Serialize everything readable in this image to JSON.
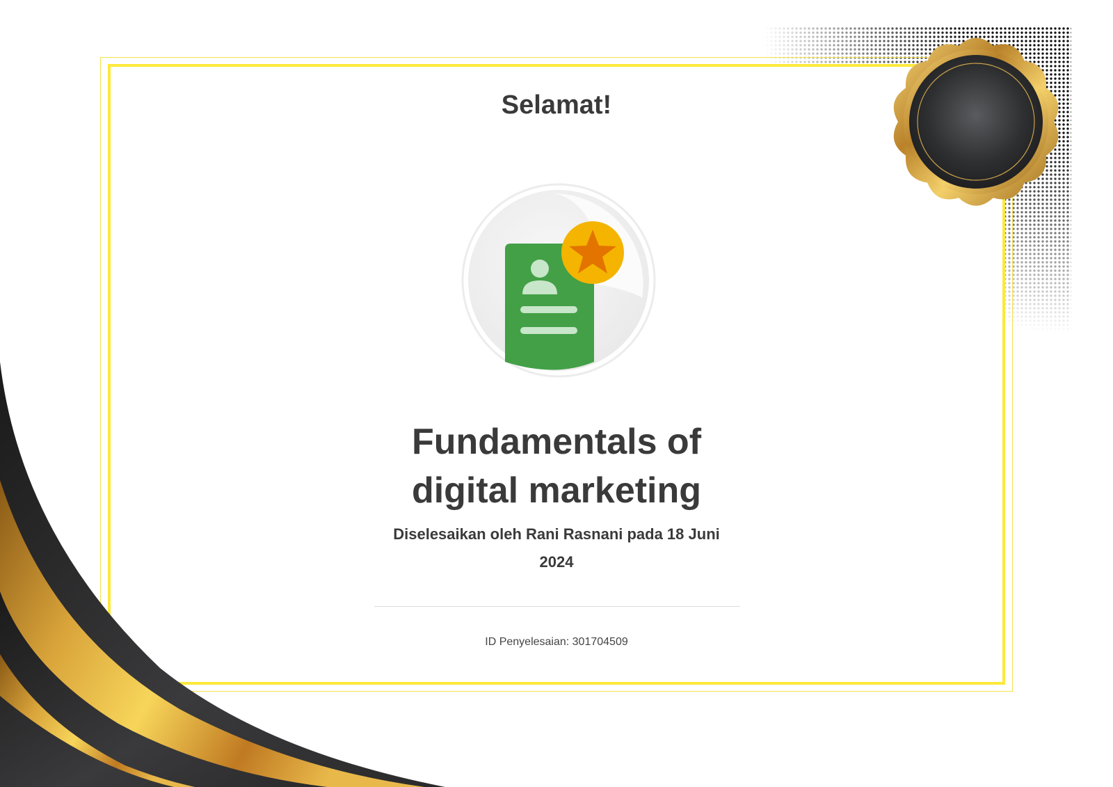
{
  "certificate": {
    "greeting": "Selamat!",
    "course_title_line1": "Fundamentals of",
    "course_title_line2": "digital marketing",
    "completed_by_line1": "Diselesaikan oleh Rani Rasnani pada 18 Juni",
    "completed_by_line2": "2024",
    "completion_id": "ID Penyelesaian: 301704509"
  },
  "icons": {
    "badge": "certificate-document-star-icon",
    "seal": "gold-seal-icon"
  },
  "colors": {
    "frame_yellow": "#fde93a",
    "badge_green": "#4caf50",
    "star_gold": "#f4b400",
    "seal_dark": "#2b2c2e",
    "gold": "#d9a43a"
  }
}
